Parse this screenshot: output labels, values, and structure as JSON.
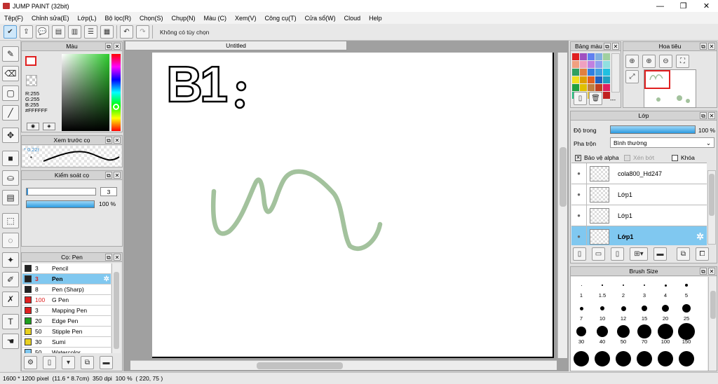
{
  "window": {
    "title": "JUMP PAINT (32bit)",
    "minimize": "—",
    "maximize": "❐",
    "close": "✕"
  },
  "menu": [
    "Tệp(F)",
    "Chỉnh sửa(E)",
    "Lớp(L)",
    "Bộ lọc(R)",
    "Chọn(S)",
    "Chụp(N)",
    "Màu (C)",
    "Xem(V)",
    "Công cụ(T)",
    "Cửa sổ(W)",
    "Cloud",
    "Help"
  ],
  "toolbar": {
    "undo_status": "Không có tùy chọn"
  },
  "document": {
    "tab_title": "Untitled"
  },
  "color_panel": {
    "title": "Màu",
    "r": "R:255",
    "g": "G:255",
    "b": "B:255",
    "hex": "#FFFFFF"
  },
  "preview_panel": {
    "title": "Xem trước cọ",
    "size": "0.22r"
  },
  "brush_control": {
    "title": "Kiểm soát cọ",
    "size_value": "3",
    "opacity_value": "100 %",
    "opacity_fraction": 1.0
  },
  "brush_list": {
    "title": "Cọ: Pen",
    "items": [
      {
        "size": "3",
        "name": "Pencil",
        "color": "#222222",
        "red": false,
        "selected": false
      },
      {
        "size": "3",
        "name": "Pen",
        "color": "#222222",
        "red": true,
        "selected": true
      },
      {
        "size": "8",
        "name": "Pen (Sharp)",
        "color": "#222222",
        "red": false,
        "selected": false
      },
      {
        "size": "100",
        "name": "G Pen",
        "color": "#e02020",
        "red": true,
        "selected": false
      },
      {
        "size": "3",
        "name": "Mapping Pen",
        "color": "#e02020",
        "red": false,
        "selected": false
      },
      {
        "size": "20",
        "name": "Edge Pen",
        "color": "#20a020",
        "red": false,
        "selected": false
      },
      {
        "size": "50",
        "name": "Stipple Pen",
        "color": "#e8d020",
        "red": false,
        "selected": false
      },
      {
        "size": "30",
        "name": "Sumi",
        "color": "#e8d020",
        "red": false,
        "selected": false
      },
      {
        "size": "50",
        "name": "Watercolor",
        "color": "#80c8f0",
        "red": false,
        "selected": false
      }
    ]
  },
  "palette_panel": {
    "title": "Bảng màu",
    "more": "---"
  },
  "navigator_panel": {
    "title": "Hoa tiêu"
  },
  "layer_panel": {
    "title": "Lớp",
    "opacity_label": "Độ trong",
    "opacity_value": "100 %",
    "blend_label": "Pha trộn",
    "blend_value": "Bình thường",
    "protect_alpha": "Bảo vệ alpha",
    "clipping": "Xén bớt",
    "lock": "Khóa",
    "layers": [
      {
        "name": "cola800_Hd247",
        "selected": false
      },
      {
        "name": "Lớp1",
        "selected": false
      },
      {
        "name": "Lớp1",
        "selected": false
      },
      {
        "name": "Lớp1",
        "selected": true
      }
    ]
  },
  "brush_size_panel": {
    "title": "Brush Size",
    "sizes": [
      "1",
      "1.5",
      "2",
      "3",
      "4",
      "5",
      "7",
      "10",
      "12",
      "15",
      "20",
      "25",
      "30",
      "40",
      "50",
      "70",
      "100",
      "150"
    ]
  },
  "canvas_text": {
    "b": "B",
    "one": "1"
  },
  "status": {
    "dims": "1600 * 1200 pixel",
    "physical": "(11.6 * 8.7cm)",
    "dpi": "350 dpi",
    "zoom": "100 %",
    "coords": "( 220, 75 )"
  }
}
